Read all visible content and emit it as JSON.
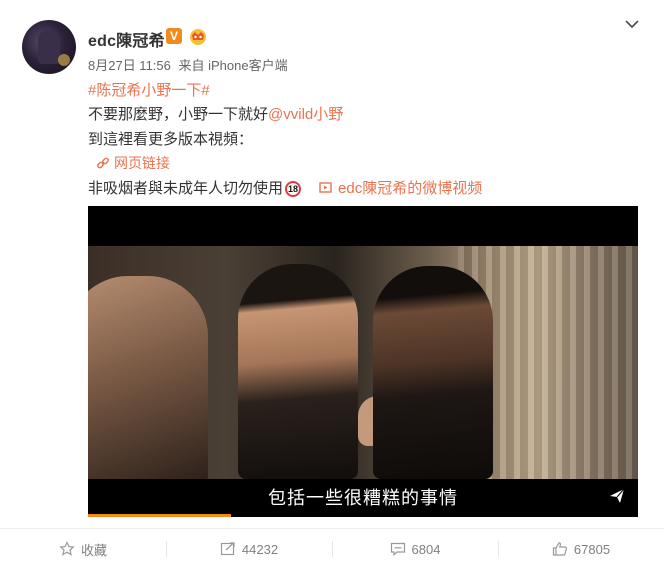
{
  "post": {
    "username": "edc陳冠希",
    "verified_badge": "V",
    "date": "8月27日 11:56",
    "source": "来自 iPhone客户端",
    "hashtag": "#陈冠希小野一下#",
    "line1_text": "不要那麼野，小野一下就好",
    "mention": "@vvild小野",
    "line2_text": "到這裡看更多版本視頻：",
    "web_link_label": "网页链接",
    "warning_text": "非吸烟者與未成年人切勿使用",
    "age_badge": "18",
    "video_link_label": "edc陳冠希的微博视频"
  },
  "video": {
    "subtitle": "包括一些很糟糕的事情",
    "progress": 0.26
  },
  "actions": {
    "favorite_label": "收藏",
    "repost_count": "44232",
    "comment_count": "6804",
    "like_count": "67805"
  },
  "colors": {
    "link": "#eb7350",
    "badge": "#f18b1d",
    "muted": "#808080"
  },
  "icons": {
    "more": "chevron-down-icon",
    "link": "link-icon",
    "video": "video-icon",
    "share": "paper-plane-icon",
    "favorite": "star-icon",
    "repost": "repost-icon",
    "comment": "comment-icon",
    "like": "thumbs-up-icon"
  }
}
